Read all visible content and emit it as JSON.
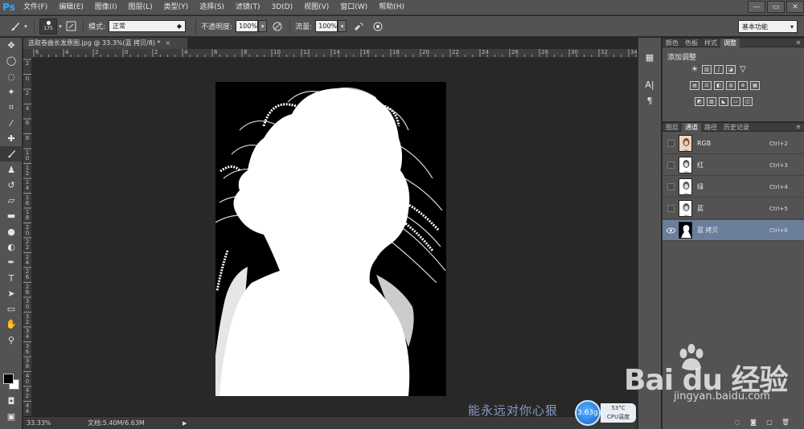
{
  "app": {
    "logo": "Ps",
    "menus": [
      "文件(F)",
      "编辑(E)",
      "图像(I)",
      "图层(L)",
      "类型(Y)",
      "选择(S)",
      "滤镜(T)",
      "3D(D)",
      "视图(V)",
      "窗口(W)",
      "帮助(H)"
    ],
    "window_controls": [
      "—",
      "▭",
      "✕"
    ]
  },
  "options": {
    "brush_size": "175",
    "mode_label": "模式:",
    "mode_value": "正常",
    "opacity_label": "不透明度:",
    "opacity_value": "100%",
    "flow_label": "流量:",
    "flow_value": "100%",
    "workspace": "基本功能"
  },
  "document": {
    "tab_title": "选取卷曲长发原图.jpg @ 33.3%(蓝 拷贝/8) *",
    "close": "×",
    "ruler_h_ticks": [
      "6",
      "4",
      "2",
      "0",
      "2",
      "4",
      "6",
      "8",
      "10",
      "12",
      "14",
      "16",
      "18",
      "20",
      "22",
      "24",
      "26",
      "28",
      "30",
      "32",
      "34"
    ],
    "ruler_v_ticks": [
      "2",
      "0",
      "2",
      "4",
      "6",
      "8",
      "1 0",
      "1 2",
      "1 4",
      "1 6",
      "1 8",
      "2 0",
      "2 2",
      "2 4",
      "2 6",
      "2 8",
      "3 0",
      "3 2",
      "3 4",
      "3 6",
      "3 8",
      "4 0",
      "4 2",
      "4 4"
    ]
  },
  "status": {
    "zoom": "33.33%",
    "doc_size": "文档:5.40M/6.63M"
  },
  "panels": {
    "top_tabs": [
      "颜色",
      "色板",
      "样式",
      "调整"
    ],
    "top_active": 3,
    "adjust_title": "添加调整",
    "channel_tabs": [
      "图层",
      "通道",
      "路径",
      "历史记录"
    ],
    "channel_active": 1,
    "channels": [
      {
        "name": "RGB",
        "shortcut": "Ctrl+2",
        "visible": false,
        "selected": false
      },
      {
        "name": "红",
        "shortcut": "Ctrl+3",
        "visible": false,
        "selected": false
      },
      {
        "name": "绿",
        "shortcut": "Ctrl+4",
        "visible": false,
        "selected": false
      },
      {
        "name": "蓝",
        "shortcut": "Ctrl+5",
        "visible": false,
        "selected": false
      },
      {
        "name": "蓝 拷贝",
        "shortcut": "Ctrl+6",
        "visible": true,
        "selected": true
      }
    ]
  },
  "overlay": {
    "watermark_text": "能永远对你心狠",
    "cpu_speed": "3.63g",
    "cpu_temp": "53°C",
    "cpu_label": "CPU温度",
    "baidu_logo": "Bai du 经验",
    "baidu_url": "jingyan.baidu.com"
  }
}
